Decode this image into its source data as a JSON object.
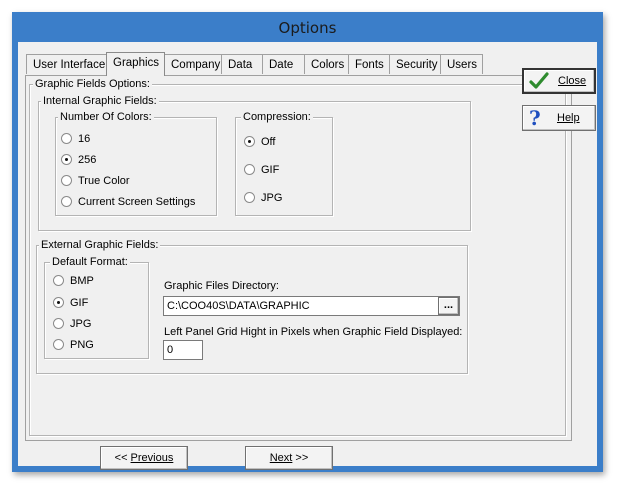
{
  "window": {
    "title": "Options"
  },
  "tabs": [
    {
      "label": "User Interface",
      "active": false
    },
    {
      "label": "Graphics",
      "active": true
    },
    {
      "label": "Company",
      "active": false
    },
    {
      "label": "Data",
      "active": false
    },
    {
      "label": "Date",
      "active": false
    },
    {
      "label": "Colors",
      "active": false
    },
    {
      "label": "Fonts",
      "active": false
    },
    {
      "label": "Security",
      "active": false
    },
    {
      "label": "Users",
      "active": false
    }
  ],
  "graphics": {
    "group_title": "Graphic Fields Options:",
    "internal": {
      "title": "Internal Graphic Fields:",
      "colors": {
        "title": "Number Of Colors:",
        "options": [
          "16",
          "256",
          "True Color",
          "Current Screen Settings"
        ],
        "selected": "256"
      },
      "compression": {
        "title": "Compression:",
        "options": [
          "Off",
          "GIF",
          "JPG"
        ],
        "selected": "Off"
      }
    },
    "external": {
      "title": "External Graphic Fields:",
      "format": {
        "title": "Default Format:",
        "options": [
          "BMP",
          "GIF",
          "JPG",
          "PNG"
        ],
        "selected": "GIF"
      },
      "directory_label": "Graphic Files Directory:",
      "directory_value": "C:\\COO40S\\DATA\\GRAPHIC",
      "browse_label": "...",
      "grid_height_label": "Left Panel Grid Hight in Pixels when Graphic Field Displayed:",
      "grid_height_value": "0"
    }
  },
  "buttons": {
    "close_label": "Close",
    "help_label": "Help",
    "previous_prefix": "<< ",
    "previous_label": "Previous",
    "next_label": "Next",
    "next_suffix": " >>"
  },
  "colors": {
    "window_frame": "#3b7ec9",
    "close_check": "#2e8b2e",
    "help_question": "#1f4fbf"
  },
  "icons": {
    "close": "check-mark-icon",
    "help": "question-mark-icon",
    "radio": "radio-button"
  }
}
